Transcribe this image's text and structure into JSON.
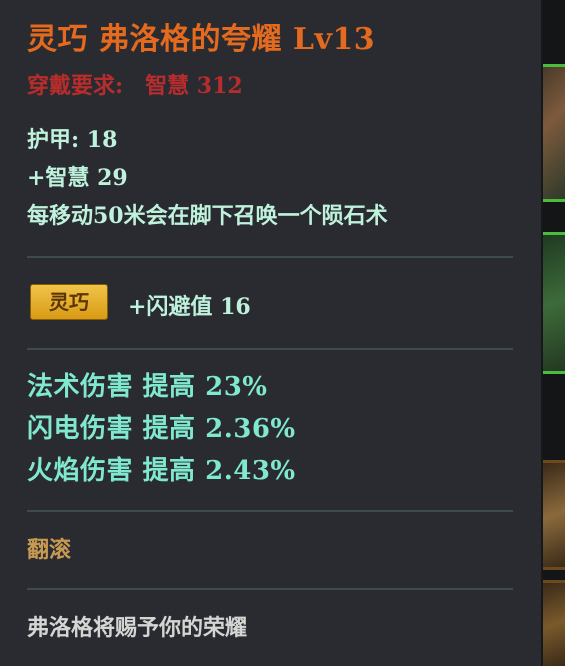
{
  "item": {
    "title": "灵巧  弗洛格的夸耀  Lv13",
    "requirement_label": "穿戴要求:",
    "requirement_value": "智慧  312",
    "stats": [
      "护甲:  18",
      "+智慧  29",
      "每移动50米会在脚下召唤一个陨石术"
    ],
    "affix_tag": "灵巧",
    "affix_bonus": "+闪避值  16",
    "damage_bonuses": [
      "法术伤害  提高  23%",
      "闪电伤害  提高  2.36%",
      "火焰伤害  提高  2.43%"
    ],
    "skill": "翻滚",
    "flavor_text": "弗洛格将赐予你的荣耀"
  },
  "colors": {
    "title": "#e36a1e",
    "requirement": "#b72c2c",
    "stat": "#bff2dc",
    "damage": "#7fe8cf",
    "skill": "#c79a53",
    "flavor": "#d4d6d4",
    "tag_bg": "#e2ac2a",
    "slot_border": "#4bbd3c"
  }
}
